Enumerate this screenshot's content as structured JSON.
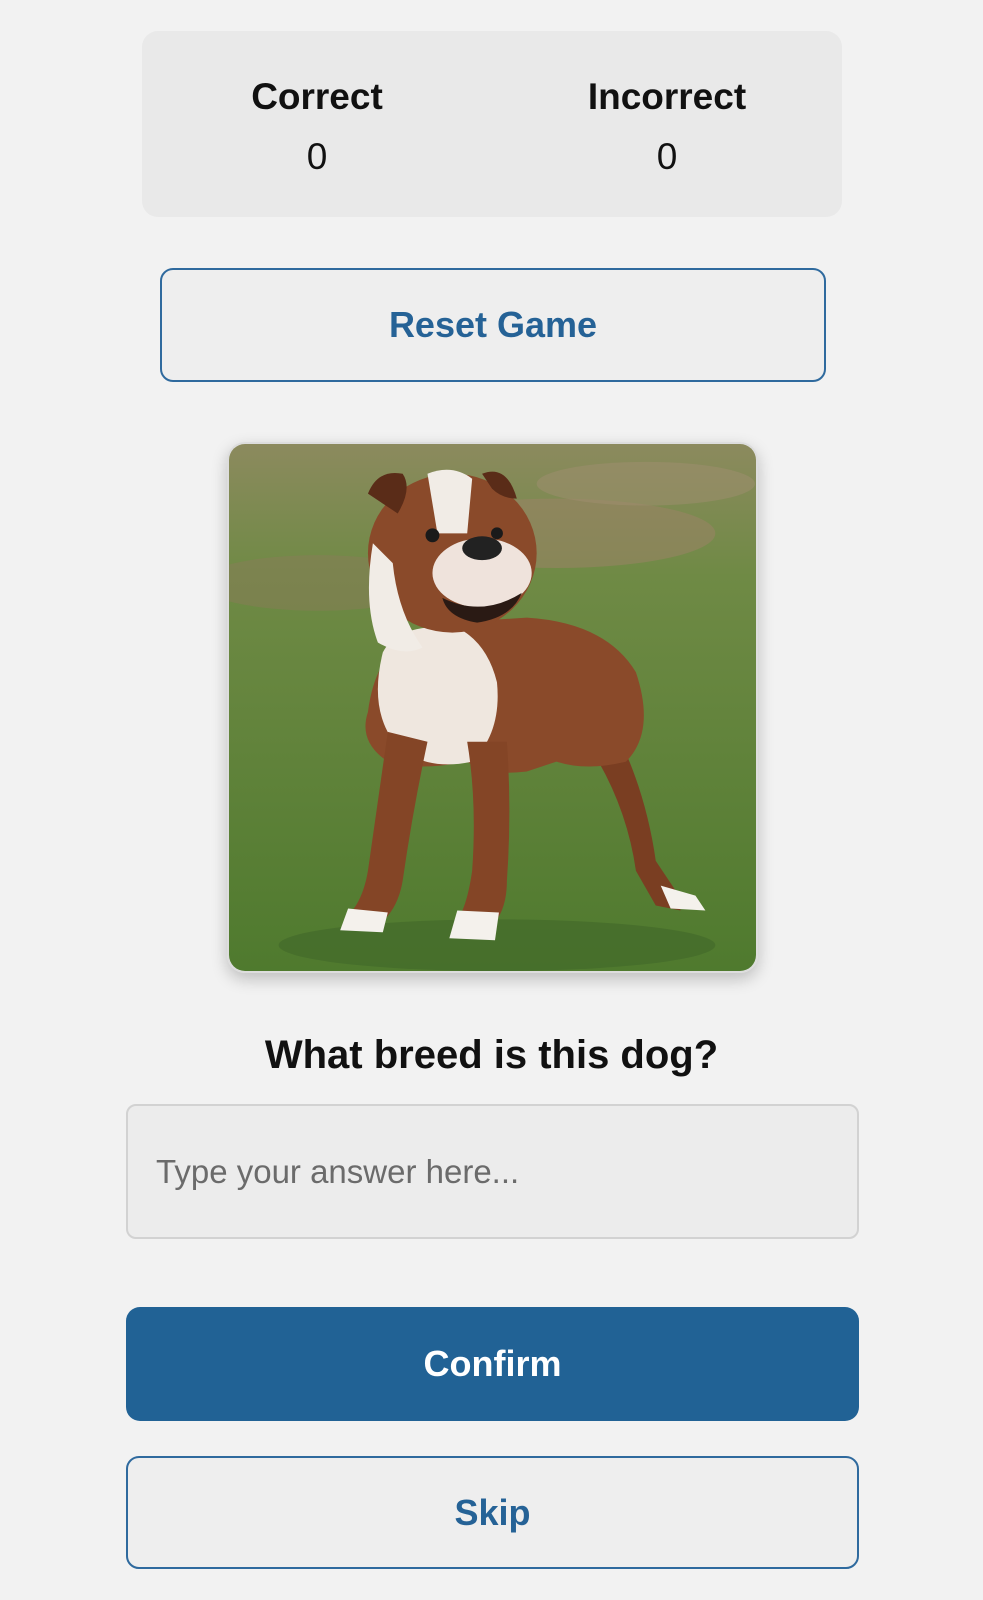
{
  "scoreboard": {
    "correct_label": "Correct",
    "correct_value": "0",
    "incorrect_label": "Incorrect",
    "incorrect_value": "0"
  },
  "controls": {
    "reset_label": "Reset Game",
    "confirm_label": "Confirm",
    "skip_label": "Skip"
  },
  "quiz": {
    "question": "What breed is this dog?",
    "answer_placeholder": "Type your answer here...",
    "answer_value": ""
  },
  "image": {
    "subject": "dog-photo"
  },
  "colors": {
    "accent": "#216295",
    "background": "#f2f2f2",
    "panel": "#e9e9e9"
  }
}
